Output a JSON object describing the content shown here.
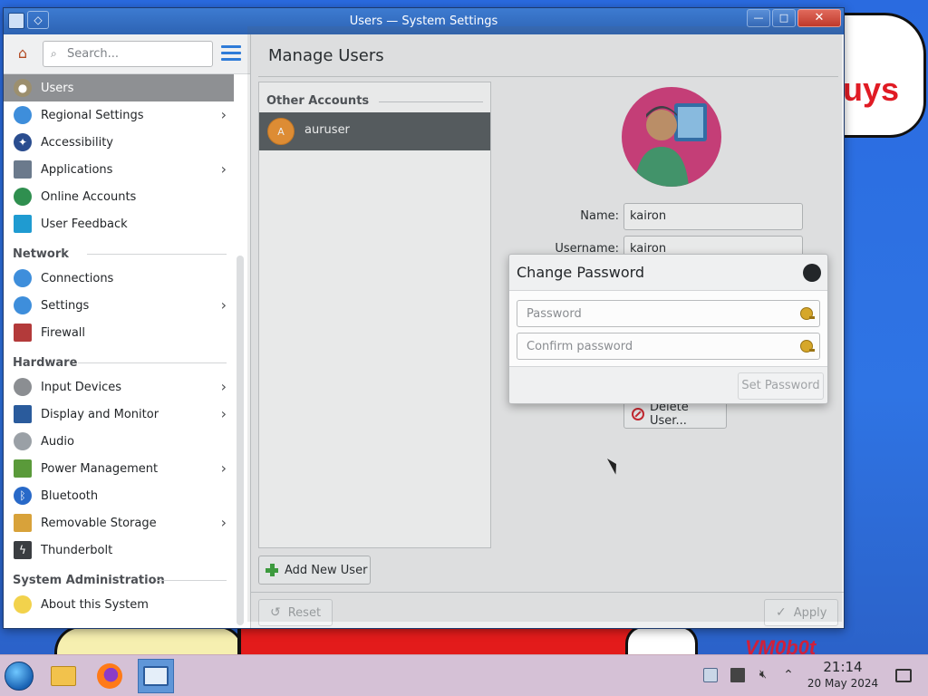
{
  "window": {
    "title": "Users — System Settings"
  },
  "sidebar": {
    "search_placeholder": "Search...",
    "items": [
      {
        "label": "Users",
        "icon": "users-icon",
        "chevron": false,
        "selected": true
      },
      {
        "label": "Regional Settings",
        "icon": "globe-icon",
        "chevron": true
      },
      {
        "label": "Accessibility",
        "icon": "accessibility-icon",
        "chevron": false
      },
      {
        "label": "Applications",
        "icon": "applications-icon",
        "chevron": true
      },
      {
        "label": "Online Accounts",
        "icon": "online-accounts-icon",
        "chevron": false
      },
      {
        "label": "User Feedback",
        "icon": "feedback-icon",
        "chevron": false
      }
    ],
    "sections": {
      "network": {
        "title": "Network",
        "items": [
          {
            "label": "Connections",
            "icon": "connections-icon",
            "chevron": false
          },
          {
            "label": "Settings",
            "icon": "network-settings-icon",
            "chevron": true
          },
          {
            "label": "Firewall",
            "icon": "firewall-icon",
            "chevron": false
          }
        ]
      },
      "hardware": {
        "title": "Hardware",
        "items": [
          {
            "label": "Input Devices",
            "icon": "input-devices-icon",
            "chevron": true
          },
          {
            "label": "Display and Monitor",
            "icon": "display-icon",
            "chevron": true
          },
          {
            "label": "Audio",
            "icon": "audio-icon",
            "chevron": false
          },
          {
            "label": "Power Management",
            "icon": "power-icon",
            "chevron": true
          },
          {
            "label": "Bluetooth",
            "icon": "bluetooth-icon",
            "chevron": false
          },
          {
            "label": "Removable Storage",
            "icon": "storage-icon",
            "chevron": true
          },
          {
            "label": "Thunderbolt",
            "icon": "thunderbolt-icon",
            "chevron": false
          }
        ]
      },
      "sysadmin": {
        "title": "System Administration",
        "items": [
          {
            "label": "About this System",
            "icon": "info-bulb-icon",
            "chevron": false
          }
        ]
      }
    }
  },
  "main": {
    "title": "Manage Users",
    "accounts_header": "Other Accounts",
    "accounts": [
      {
        "initial": "A",
        "name": "auruser"
      }
    ],
    "add_user_label": "Add New User",
    "name_label": "Name:",
    "name_value": "kairon",
    "username_label": "Username:",
    "username_value": "kairon",
    "delete_user_label": "Delete User...",
    "reset_label": "Reset",
    "apply_label": "Apply"
  },
  "dialog": {
    "title": "Change Password",
    "password_placeholder": "Password",
    "confirm_placeholder": "Confirm password",
    "set_password_label": "Set Password"
  },
  "desktop": {
    "cloud_text": "uys",
    "tag_text": "VM0b0t"
  },
  "taskbar": {
    "time": "21:14",
    "date": "20 May 2024"
  },
  "colors": {
    "selection": "#8e9093",
    "account_row": "#555a5e",
    "accent": "#2e7bd8",
    "titlebar": "#2d63b3"
  }
}
